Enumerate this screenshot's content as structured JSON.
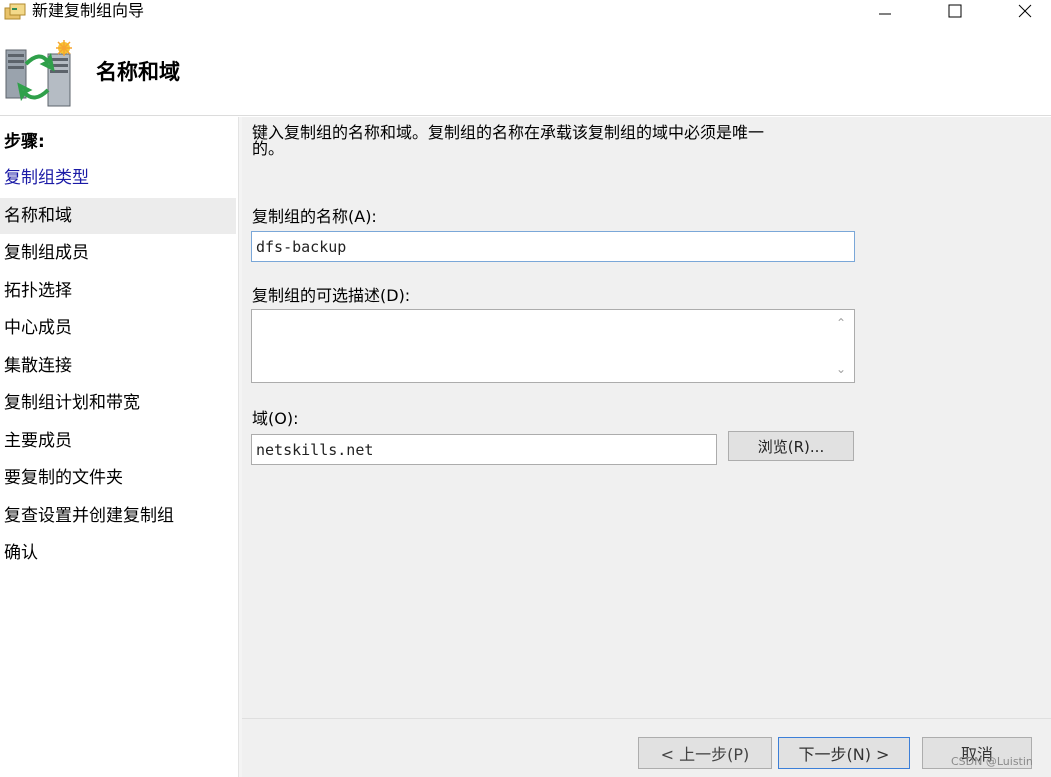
{
  "window": {
    "title": "新建复制组向导",
    "minimize_icon": "minimize-icon",
    "maximize_icon": "maximize-icon",
    "close_icon": "close-icon"
  },
  "header": {
    "title": "名称和域",
    "icon": "replication-servers-icon"
  },
  "steps": {
    "label": "步骤:",
    "items": [
      {
        "label": "复制组类型",
        "state": "link"
      },
      {
        "label": "名称和域",
        "state": "current"
      },
      {
        "label": "复制组成员",
        "state": "pending"
      },
      {
        "label": "拓扑选择",
        "state": "pending"
      },
      {
        "label": "中心成员",
        "state": "pending"
      },
      {
        "label": "集散连接",
        "state": "pending"
      },
      {
        "label": "复制组计划和带宽",
        "state": "pending"
      },
      {
        "label": "主要成员",
        "state": "pending"
      },
      {
        "label": "要复制的文件夹",
        "state": "pending"
      },
      {
        "label": "复查设置并创建复制组",
        "state": "pending"
      },
      {
        "label": "确认",
        "state": "pending"
      }
    ]
  },
  "main": {
    "instruction_line1": "键入复制组的名称和域。复制组的名称在承载该复制组的域中必须是唯一",
    "instruction_line2": "的。",
    "name_label": "复制组的名称(A):",
    "name_value": "dfs-backup",
    "description_label": "复制组的可选描述(D):",
    "description_value": "",
    "domain_label": "域(O):",
    "domain_value": "netskills.net",
    "browse_label": "浏览(R)..."
  },
  "footer": {
    "back_label": "< 上一步(P)",
    "next_label": "下一步(N) >",
    "cancel_label": "取消"
  },
  "watermark": "CSDN @Luistin",
  "colors": {
    "link": "#1a1aa6",
    "current_step_bg": "#ececec",
    "pane_bg": "#f0f0f0",
    "focus_border": "#7aa7d8",
    "default_button_border": "#3c7fd8"
  }
}
